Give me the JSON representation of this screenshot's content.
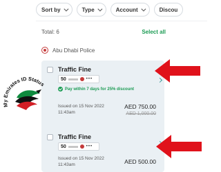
{
  "filters": [
    {
      "label": "Sort by"
    },
    {
      "label": "Type"
    },
    {
      "label": "Account"
    },
    {
      "label": "Discou"
    }
  ],
  "summary": {
    "total": "Total: 6",
    "select_all": "Select all"
  },
  "issuer": {
    "name": "Abu Dhabi Police"
  },
  "fines": [
    {
      "title": "Traffic Fine",
      "plate_code": "50",
      "plate_number": "•••",
      "discount": "Pay within 7 days for 25% discount",
      "issued_on": "Issued on 15 Nov 2022",
      "issued_time": "11:43am",
      "amount": "AED 750.00",
      "original_amount": "AED 1,000.00"
    },
    {
      "title": "Traffic Fine",
      "plate_code": "50",
      "plate_number": "•••",
      "issued_on": "Issued on 15 Nov 2022",
      "issued_time": "11:43am",
      "amount": "AED 500.00"
    }
  ],
  "watermark": {
    "text": "My Emirates ID Status"
  },
  "colors": {
    "accent_green": "#1b9b53",
    "arrow_red": "#e0121b",
    "card_bg": "#eaf0f4"
  }
}
